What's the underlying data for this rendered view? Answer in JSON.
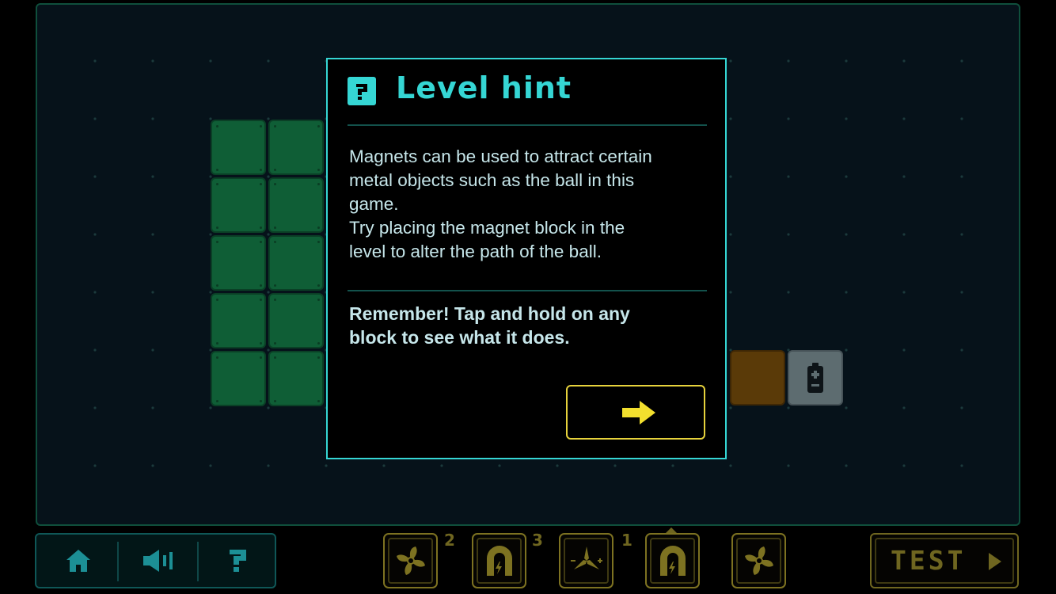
{
  "hint": {
    "title": "Level hint",
    "body": "Magnets can be used to attract certain\nmetal objects such as the ball in this\ngame.\nTry placing the magnet block in the\nlevel to alter the path of the ball.",
    "remember": "Remember! Tap and hold on any\nblock to see what it does.",
    "icon": "question-block-icon",
    "next_icon": "arrow-right-icon"
  },
  "toolbar": {
    "buttons": [
      {
        "name": "home",
        "icon": "home-icon"
      },
      {
        "name": "sound",
        "icon": "speaker-icon"
      },
      {
        "name": "help",
        "icon": "question-icon"
      }
    ]
  },
  "inventory": [
    {
      "icon": "fan-icon",
      "count": "2"
    },
    {
      "icon": "magnet-icon",
      "count": "3"
    },
    {
      "icon": "propeller-icon",
      "count": "1"
    },
    {
      "icon": "magnet-icon",
      "count": "",
      "selected": true
    },
    {
      "icon": "fan-icon",
      "count": ""
    }
  ],
  "test_button": {
    "label": "TEST",
    "icon": "play-icon"
  },
  "colors": {
    "accent": "#35d6d4",
    "board_border": "#0f4f3c",
    "green_block": "#0f5e36",
    "brown_block": "#5a3a08",
    "battery_block": "#5d6c70",
    "inventory_gold": "#6f6620",
    "next_button_yellow": "#e6d23c"
  }
}
